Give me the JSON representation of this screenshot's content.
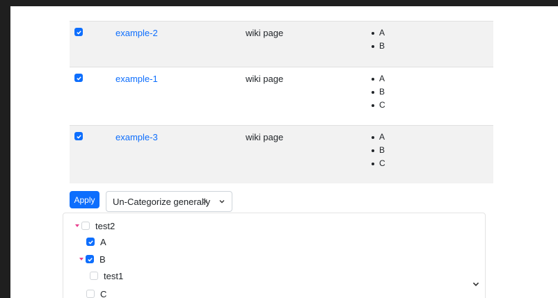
{
  "table": {
    "rows": [
      {
        "checked": true,
        "name": "example-2",
        "type": "wiki page",
        "items": [
          "A",
          "B"
        ]
      },
      {
        "checked": true,
        "name": "example-1",
        "type": "wiki page",
        "items": [
          "A",
          "B",
          "C"
        ]
      },
      {
        "checked": true,
        "name": "example-3",
        "type": "wiki page",
        "items": [
          "A",
          "B",
          "C"
        ]
      }
    ]
  },
  "controls": {
    "apply_label": "Apply",
    "select_value": "Un-Categorize generally",
    "clear_glyph": "×"
  },
  "tree": {
    "nodes": [
      {
        "label": "test2",
        "checked": false,
        "expanded": true
      },
      {
        "label": "A",
        "checked": true
      },
      {
        "label": "B",
        "checked": true,
        "expanded": true
      },
      {
        "label": "test1",
        "checked": false
      },
      {
        "label": "C",
        "checked": false
      }
    ]
  },
  "colors": {
    "accent": "#0d6efd",
    "caret": "#e83e8c",
    "row_shade": "#f2f2f2"
  }
}
